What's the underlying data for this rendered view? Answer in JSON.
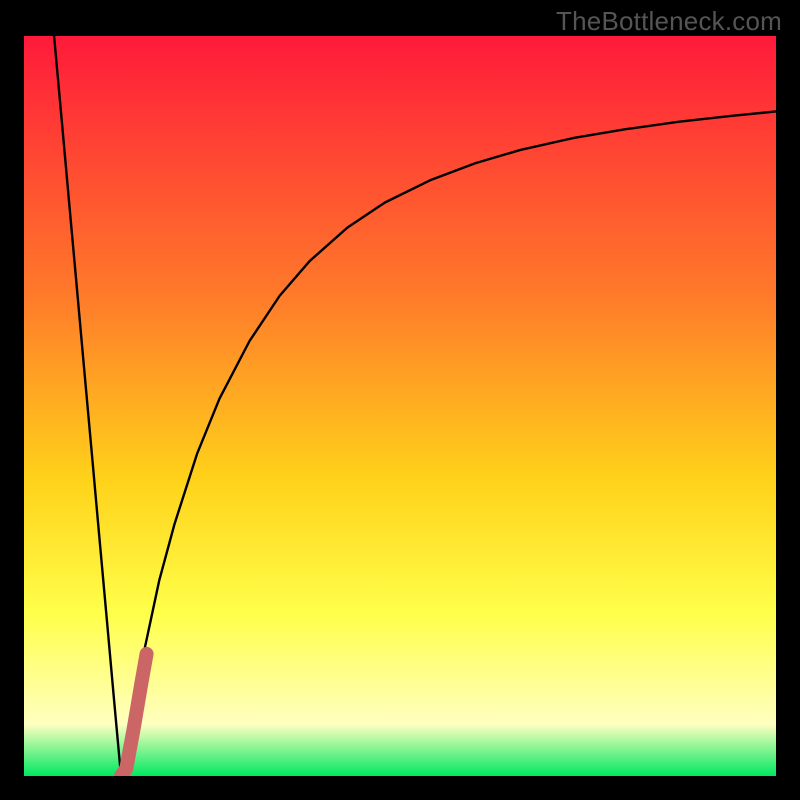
{
  "watermark": "TheBottleneck.com",
  "colors": {
    "gradient_top": "#ff1a3a",
    "gradient_mid1": "#ff7a2a",
    "gradient_mid2": "#ffd21a",
    "gradient_mid3": "#ffff4a",
    "gradient_pale": "#ffffc0",
    "gradient_bottom": "#00e861",
    "curve": "#000000",
    "marker": "#cc6666",
    "frame": "#000000"
  },
  "chart_data": {
    "type": "line",
    "title": "",
    "xlabel": "",
    "ylabel": "",
    "xlim": [
      0,
      100
    ],
    "ylim": [
      0,
      100
    ],
    "series": [
      {
        "name": "left-branch",
        "x": [
          4.0,
          5.0,
          6.0,
          7.0,
          8.0,
          9.0,
          10.0,
          11.0,
          12.0,
          12.9
        ],
        "values": [
          100.0,
          88.8,
          77.5,
          66.3,
          55.0,
          43.8,
          32.5,
          21.3,
          10.0,
          0.0
        ]
      },
      {
        "name": "right-branch",
        "x": [
          12.9,
          14,
          16,
          18,
          20,
          23,
          26,
          30,
          34,
          38,
          43,
          48,
          54,
          60,
          66,
          73,
          80,
          87,
          94,
          100
        ],
        "values": [
          0.0,
          6.5,
          17.0,
          26.5,
          34.0,
          43.5,
          51.0,
          58.8,
          64.9,
          69.6,
          74.1,
          77.5,
          80.5,
          82.8,
          84.6,
          86.2,
          87.4,
          88.4,
          89.2,
          89.8
        ]
      }
    ],
    "marker": {
      "name": "optimal-segment",
      "x": [
        12.9,
        13.6,
        14.6,
        15.6,
        16.3
      ],
      "values": [
        0.0,
        1.0,
        6.5,
        12.5,
        16.5
      ]
    }
  }
}
